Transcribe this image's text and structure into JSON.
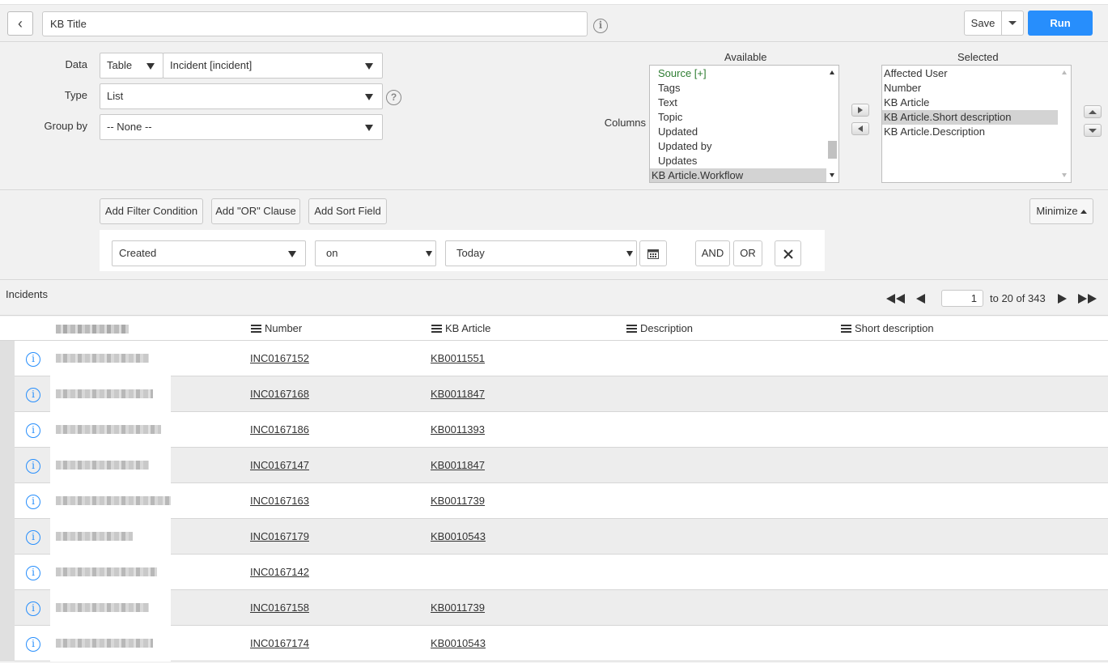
{
  "header": {
    "title_value": "KB Title",
    "save_label": "Save",
    "run_label": "Run"
  },
  "config": {
    "data_label": "Data",
    "data_source": "Table",
    "data_table": "Incident [incident]",
    "type_label": "Type",
    "type_value": "List",
    "groupby_label": "Group by",
    "groupby_value": "-- None --",
    "columns_label": "Columns",
    "available_header": "Available",
    "selected_header": "Selected",
    "available": [
      "Source [+]",
      "Tags",
      "Text",
      "Topic",
      "Updated",
      "Updated by",
      "Updates",
      "KB Article.Workflow"
    ],
    "selected": [
      "Affected User",
      "Number",
      "KB Article",
      "KB Article.Short description",
      "KB Article.Description"
    ]
  },
  "filter": {
    "add_condition": "Add Filter Condition",
    "add_or": "Add \"OR\" Clause",
    "add_sort": "Add Sort Field",
    "minimize": "Minimize",
    "field": "Created",
    "operator": "on",
    "value": "Today",
    "and_label": "AND",
    "or_label": "OR"
  },
  "results": {
    "title": "Incidents",
    "page": "1",
    "range": "to 20 of 343"
  },
  "table": {
    "columns": [
      "Number",
      "KB Article",
      "Description",
      "Short description"
    ],
    "rows": [
      {
        "number": "INC0167152",
        "kb": "KB0011551"
      },
      {
        "number": "INC0167168",
        "kb": "KB0011847"
      },
      {
        "number": "INC0167186",
        "kb": "KB0011393"
      },
      {
        "number": "INC0167147",
        "kb": "KB0011847"
      },
      {
        "number": "INC0167163",
        "kb": "KB0011739"
      },
      {
        "number": "INC0167179",
        "kb": "KB0010543"
      },
      {
        "number": "INC0167142",
        "kb": ""
      },
      {
        "number": "INC0167158",
        "kb": "KB0011739"
      },
      {
        "number": "INC0167174",
        "kb": "KB0010543"
      }
    ]
  },
  "colors": {
    "accent": "#278efc",
    "green_item": "#2e7d32"
  }
}
